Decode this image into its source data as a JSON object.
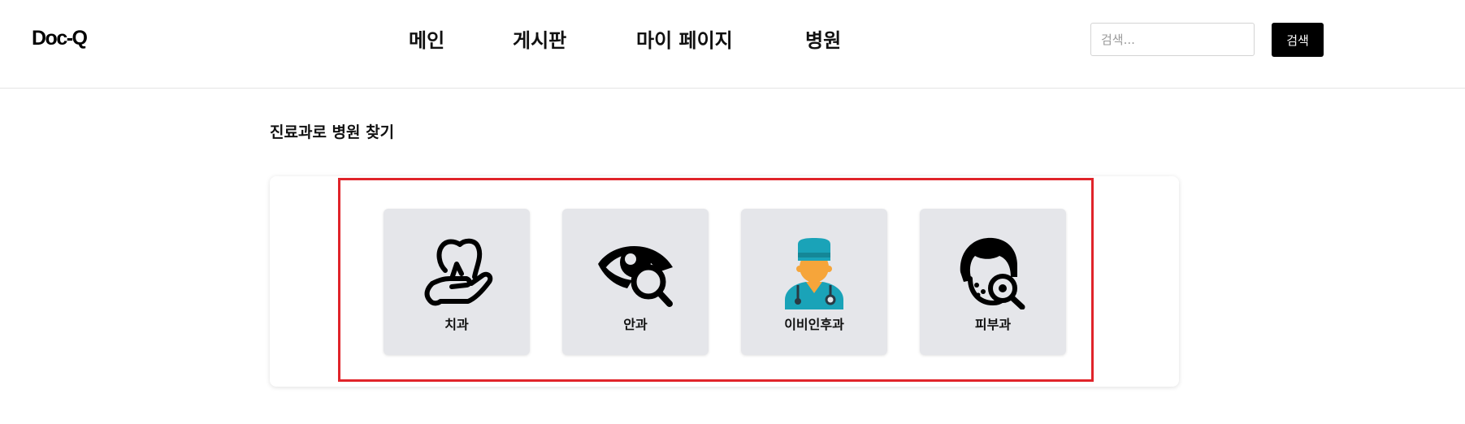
{
  "header": {
    "logo": "Doc-Q",
    "nav": [
      {
        "label": "메인"
      },
      {
        "label": "게시판"
      },
      {
        "label": "마이 페이지"
      },
      {
        "label": "병원"
      }
    ],
    "search": {
      "placeholder": "검색...",
      "value": "",
      "button_label": "검색"
    }
  },
  "main": {
    "section_title": "진료과로 병원 찾기",
    "departments": [
      {
        "label": "치과",
        "icon": "tooth-hand-icon"
      },
      {
        "label": "안과",
        "icon": "eye-search-icon"
      },
      {
        "label": "이비인후과",
        "icon": "doctor-icon"
      },
      {
        "label": "피부과",
        "icon": "skin-search-icon"
      }
    ]
  },
  "colors": {
    "highlight_border": "#e0242a",
    "card_background": "#e5e6ea",
    "button_background": "#000000",
    "doctor_cap": "#1aa3b8",
    "doctor_skin": "#f6a53a"
  }
}
